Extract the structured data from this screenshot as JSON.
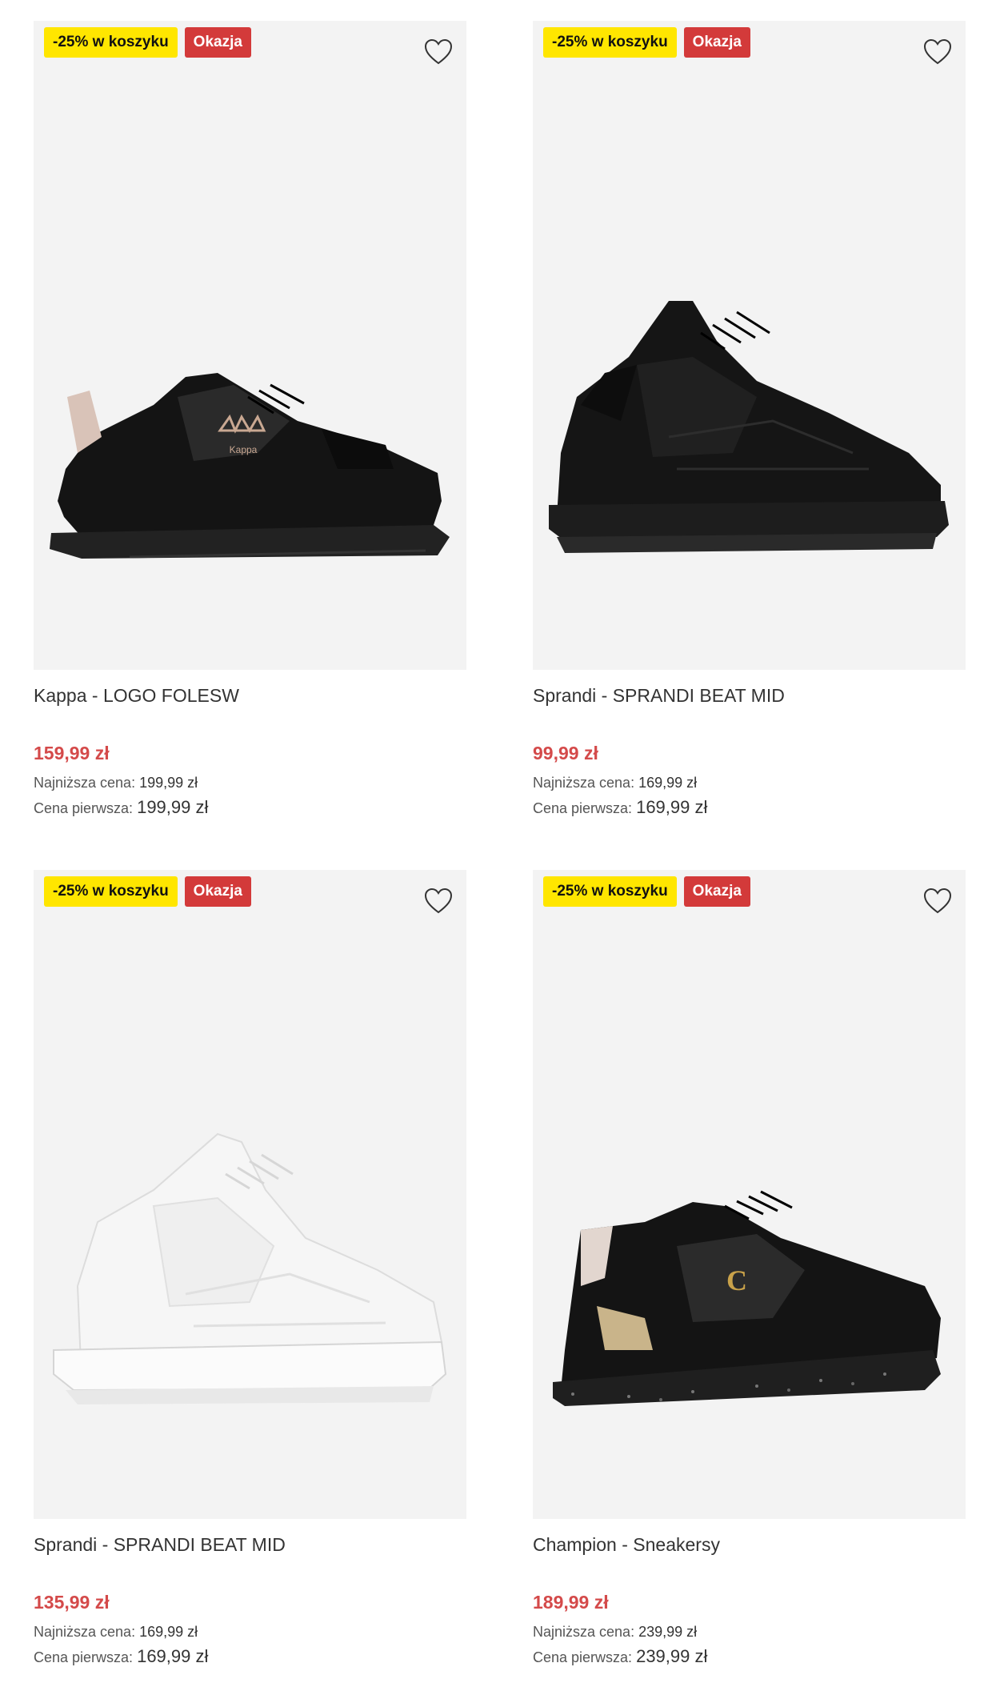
{
  "products": [
    {
      "badge_promo": "-25% w koszyku",
      "badge_deal": "Okazja",
      "name": "Kappa - LOGO FOLESW",
      "price": "159,99 zł",
      "lowest_label": "Najniższa cena:",
      "lowest_value": "199,99 zł",
      "first_label": "Cena pierwsza:",
      "first_value": "199,99 zł",
      "image_icon": "black-kappa-sneaker",
      "image_logo": "Kappa"
    },
    {
      "badge_promo": "-25% w koszyku",
      "badge_deal": "Okazja",
      "name": "Sprandi - SPRANDI BEAT MID",
      "price": "99,99 zł",
      "lowest_label": "Najniższa cena:",
      "lowest_value": "169,99 zł",
      "first_label": "Cena pierwsza:",
      "first_value": "169,99 zł",
      "image_icon": "black-high-top-sneaker"
    },
    {
      "badge_promo": "-25% w koszyku",
      "badge_deal": "Okazja",
      "name": "Sprandi - SPRANDI BEAT MID",
      "price": "135,99 zł",
      "lowest_label": "Najniższa cena:",
      "lowest_value": "169,99 zł",
      "first_label": "Cena pierwsza:",
      "first_value": "169,99 zł",
      "image_icon": "white-high-top-sneaker"
    },
    {
      "badge_promo": "-25% w koszyku",
      "badge_deal": "Okazja",
      "name": "Champion - Sneakersy",
      "price": "189,99 zł",
      "lowest_label": "Najniższa cena:",
      "lowest_value": "239,99 zł",
      "first_label": "Cena pierwsza:",
      "first_value": "239,99 zł",
      "image_icon": "black-champion-sneaker",
      "image_logo": "C"
    }
  ],
  "colors": {
    "promo_badge": "#ffe600",
    "deal_badge": "#d33a3a",
    "price": "#d44a4a",
    "image_bg": "#f3f3f3"
  },
  "icons": {
    "wishlist": "heart-outline-icon"
  }
}
